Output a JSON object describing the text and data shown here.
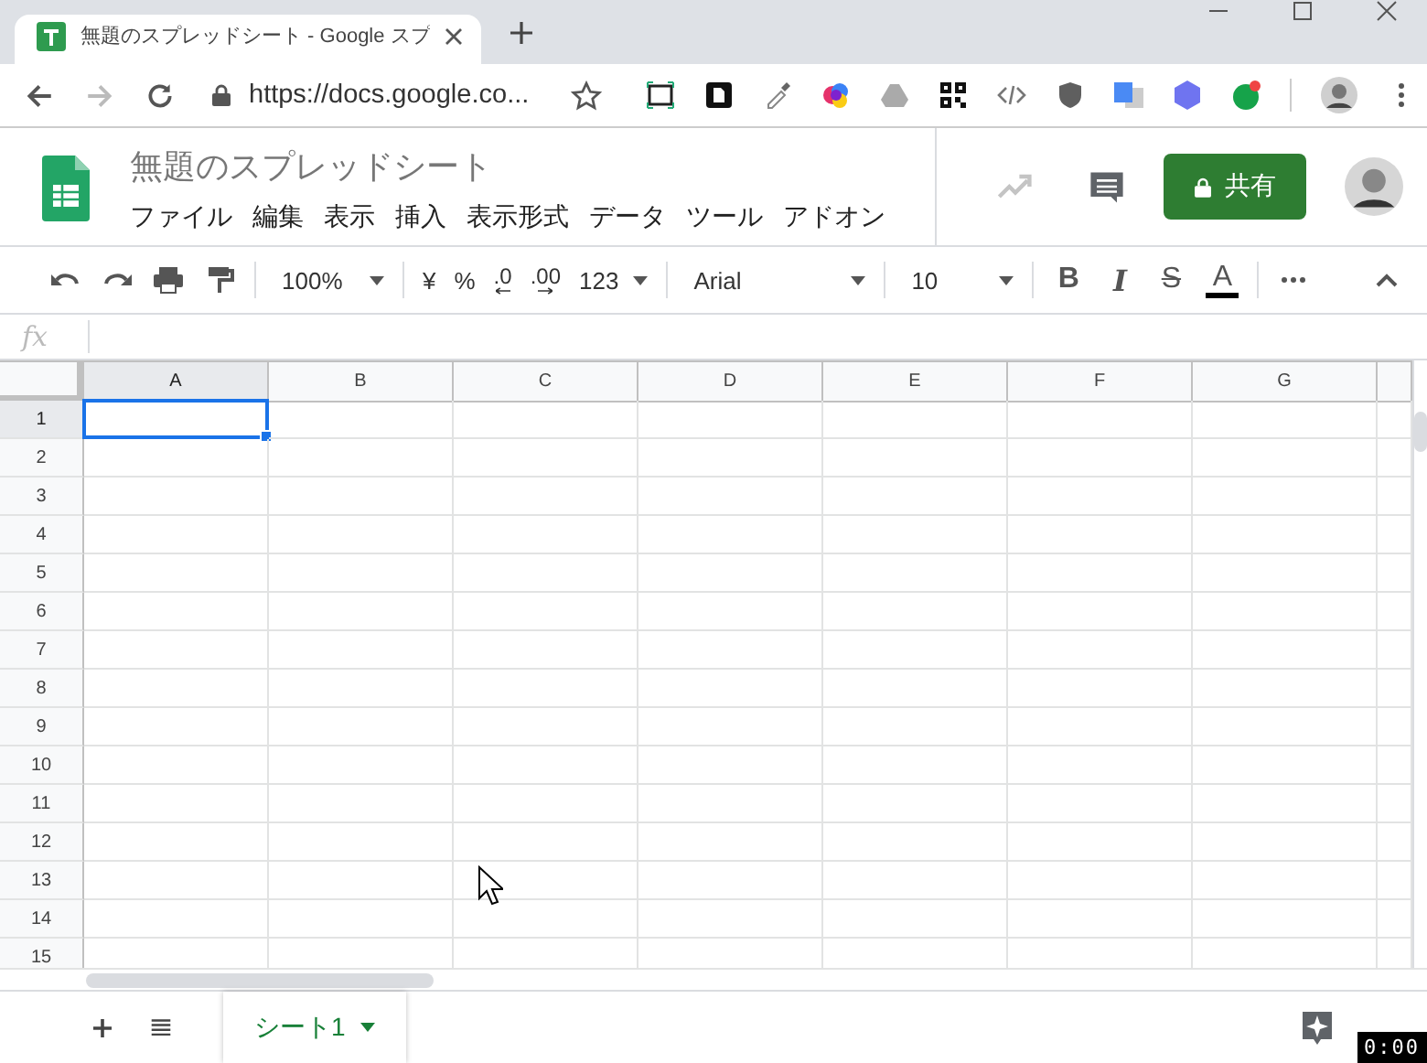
{
  "browser": {
    "tab_title": "無題のスプレッドシート - Google スプ",
    "address": "https://docs.google.co..."
  },
  "doc": {
    "title": "無題のスプレッドシート",
    "menus": [
      "ファイル",
      "編集",
      "表示",
      "挿入",
      "表示形式",
      "データ",
      "ツール",
      "アドオン"
    ],
    "share_label": "共有"
  },
  "toolbar": {
    "zoom": "100%",
    "currency": "¥",
    "percent": "%",
    "decrease_decimals": ".0",
    "increase_decimals": ".00",
    "number_format": "123",
    "font": "Arial",
    "font_size": "10",
    "format_buttons": [
      "B",
      "I",
      "S",
      "A"
    ]
  },
  "formula_bar": {
    "label": "fx"
  },
  "grid": {
    "columns": [
      {
        "label": "A",
        "selected": true
      },
      {
        "label": "B",
        "selected": false
      },
      {
        "label": "C",
        "selected": false
      },
      {
        "label": "D",
        "selected": false
      },
      {
        "label": "E",
        "selected": false
      },
      {
        "label": "F",
        "selected": false
      },
      {
        "label": "G",
        "selected": false
      }
    ],
    "rows": [
      {
        "label": "1",
        "selected": true
      },
      {
        "label": "2",
        "selected": false
      },
      {
        "label": "3",
        "selected": false
      },
      {
        "label": "4",
        "selected": false
      },
      {
        "label": "5",
        "selected": false
      },
      {
        "label": "6",
        "selected": false
      },
      {
        "label": "7",
        "selected": false
      },
      {
        "label": "8",
        "selected": false
      },
      {
        "label": "9",
        "selected": false
      },
      {
        "label": "10",
        "selected": false
      },
      {
        "label": "11",
        "selected": false
      },
      {
        "label": "12",
        "selected": false
      },
      {
        "label": "13",
        "selected": false
      },
      {
        "label": "14",
        "selected": false
      },
      {
        "label": "15",
        "selected": false
      }
    ]
  },
  "sheets": [
    {
      "label": "シート1",
      "selected": true
    }
  ],
  "timer": "0:00"
}
